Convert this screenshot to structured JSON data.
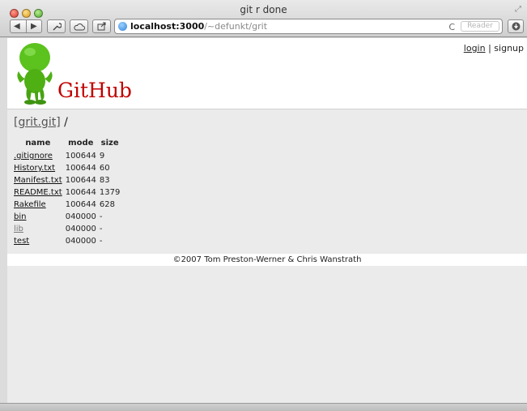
{
  "window": {
    "title": "git r done",
    "url_host": "localhost:3000",
    "url_path": "/~defunkt/grit",
    "reader_label": "Reader",
    "reload_glyph": "C"
  },
  "header": {
    "brand": "GitHub",
    "login": "login",
    "separator": "|",
    "signup": "signup"
  },
  "breadcrumb": {
    "repo": "[grit.git]",
    "path": "/"
  },
  "table": {
    "columns": [
      "name",
      "mode",
      "size"
    ],
    "rows": [
      {
        "name": ".gitignore",
        "mode": "100644",
        "size": "9"
      },
      {
        "name": "History.txt",
        "mode": "100644",
        "size": "60"
      },
      {
        "name": "Manifest.txt",
        "mode": "100644",
        "size": "83"
      },
      {
        "name": "README.txt",
        "mode": "100644",
        "size": "1379"
      },
      {
        "name": "Rakefile",
        "mode": "100644",
        "size": "628"
      },
      {
        "name": "bin",
        "mode": "040000",
        "size": "-"
      },
      {
        "name": "lib",
        "mode": "040000",
        "size": "-"
      },
      {
        "name": "test",
        "mode": "040000",
        "size": "-"
      }
    ]
  },
  "footer": {
    "text": "©2007 Tom Preston-Werner & Chris Wanstrath"
  },
  "colors": {
    "brand_red": "#c00000",
    "mascot_green": "#5cc21e"
  },
  "icons": {
    "back": "◀",
    "forward": "▶",
    "wrench": "wrench-icon",
    "cloud": "cloud-icon",
    "share": "share-icon",
    "download": "download-icon"
  }
}
